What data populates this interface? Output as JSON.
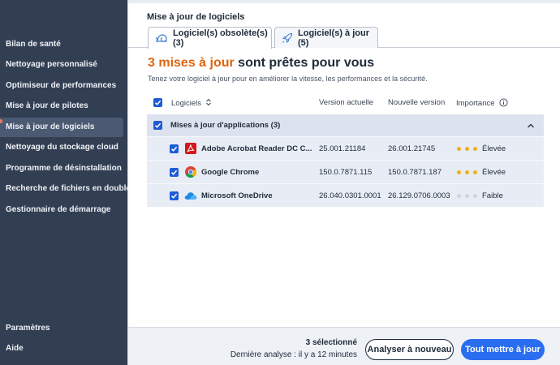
{
  "sidebar": {
    "items": [
      {
        "label": "Bilan de santé"
      },
      {
        "label": "Nettoyage personnalisé"
      },
      {
        "label": "Optimiseur de performances"
      },
      {
        "label": "Mise à jour de pilotes"
      },
      {
        "label": "Mise à jour de logiciels",
        "active": true
      },
      {
        "label": "Nettoyage du stockage cloud"
      },
      {
        "label": "Programme de désinstallation"
      },
      {
        "label": "Recherche de fichiers en double"
      },
      {
        "label": "Gestionnaire de démarrage"
      }
    ],
    "bottom_items": [
      {
        "label": "Paramètres"
      },
      {
        "label": "Aide"
      }
    ]
  },
  "page": {
    "title": "Mise à jour de logiciels",
    "tabs": [
      {
        "label": "Logiciel(s) obsolète(s) (3)",
        "active": true,
        "icon": "snail-icon"
      },
      {
        "label": "Logiciel(s) à jour (5)",
        "active": false,
        "icon": "rocket-icon"
      }
    ],
    "headline_accent": "3 mises à jour",
    "headline_rest": " sont prêtes pour vous",
    "subline": "Tenez votre logiciel à jour pour en améliorer la vitesse, les performances et la sécurité."
  },
  "table": {
    "headers": {
      "software": "Logiciels",
      "current": "Version actuelle",
      "new": "Nouvelle version",
      "importance": "Importance"
    },
    "group_label": "Mises à jour d'applications (3)",
    "rows": [
      {
        "name": "Adobe Acrobat Reader DC C...",
        "current": "25.001.21184",
        "new": "26.001.21745",
        "importance": "Élevée",
        "level": 3,
        "icon": "acrobat-icon"
      },
      {
        "name": "Google Chrome",
        "current": "150.0.7871.115",
        "new": "150.0.7871.187",
        "importance": "Élevée",
        "level": 3,
        "icon": "chrome-icon"
      },
      {
        "name": "Microsoft OneDrive",
        "current": "26.040.0301.0001",
        "new": "26.129.0706.0003",
        "importance": "Faible",
        "level": 0,
        "icon": "onedrive-icon"
      }
    ]
  },
  "footer": {
    "selected": "3 sélectionné",
    "last_scan": "Dernière analyse : il y a 12 minutes",
    "rescan_label": "Analyser à nouveau",
    "update_all_label": "Tout mettre à jour"
  },
  "colors": {
    "sidebar_bg": "#323f53",
    "accent_orange": "#e0650f",
    "primary_blue": "#2a6df0",
    "checkbox_blue": "#1e5bd6",
    "importance_high": "#f2b01e",
    "importance_low": "#cfd4dc"
  }
}
